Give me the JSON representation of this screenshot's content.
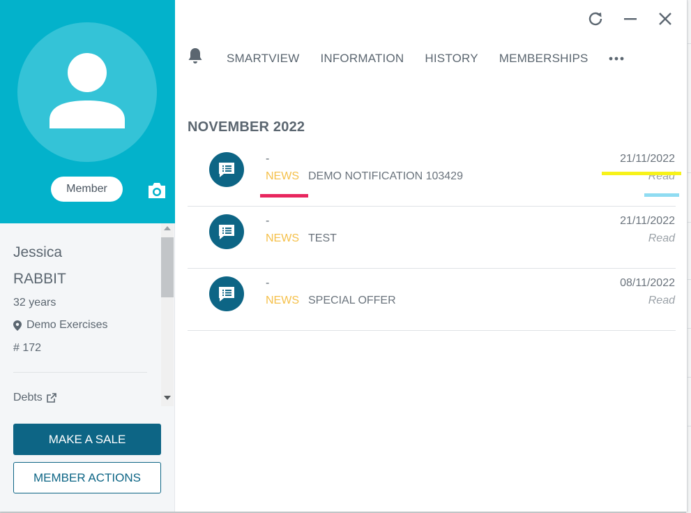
{
  "profile": {
    "badge": "Member",
    "first_name": "Jessica",
    "last_name": "RABBIT",
    "age": "32 years",
    "location": "Demo Exercises",
    "member_number": "# 172",
    "debts_label": "Debts"
  },
  "actions": {
    "make_sale": "MAKE A SALE",
    "member_actions": "MEMBER ACTIONS"
  },
  "tabs": [
    {
      "label": "SMARTVIEW"
    },
    {
      "label": "INFORMATION"
    },
    {
      "label": "HISTORY"
    },
    {
      "label": "MEMBERSHIPS"
    }
  ],
  "notifications": {
    "month": "NOVEMBER 2022",
    "items": [
      {
        "dash": "-",
        "category": "NEWS",
        "title": "DEMO NOTIFICATION 103429",
        "date": "21/11/2022",
        "status": "Read"
      },
      {
        "dash": "-",
        "category": "NEWS",
        "title": "TEST",
        "date": "21/11/2022",
        "status": "Read"
      },
      {
        "dash": "-",
        "category": "NEWS",
        "title": "SPECIAL OFFER",
        "date": "08/11/2022",
        "status": "Read"
      }
    ]
  },
  "icons": {
    "refresh": "refresh-icon",
    "minimize": "minimize-icon",
    "close": "close-icon",
    "bell": "bell-icon",
    "more": "more-horizontal-icon",
    "camera": "camera-icon",
    "pin": "map-pin-icon",
    "external": "external-link-icon",
    "notification": "message-list-icon"
  },
  "colors": {
    "teal_header": "#03b2cb",
    "primary": "#0d6585",
    "category": "#f5c04a",
    "highlight_yellow": "#f7f21a",
    "highlight_pink": "#e8265e",
    "highlight_blue": "#8fdcf2"
  }
}
